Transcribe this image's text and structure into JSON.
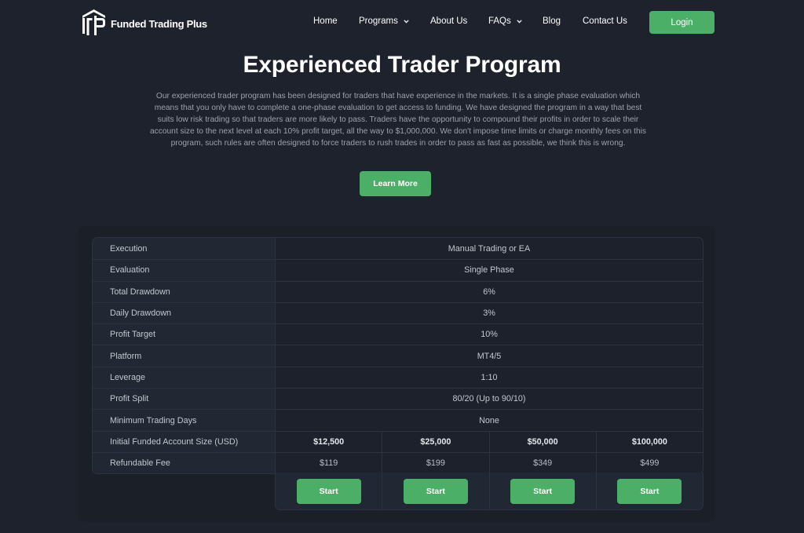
{
  "brand": {
    "name": "Funded Trading Plus",
    "accent_color": "#4caf68"
  },
  "nav": {
    "items": [
      {
        "label": "Home",
        "has_dropdown": false
      },
      {
        "label": "Programs",
        "has_dropdown": true
      },
      {
        "label": "About Us",
        "has_dropdown": false
      },
      {
        "label": "FAQs",
        "has_dropdown": true
      },
      {
        "label": "Blog",
        "has_dropdown": false
      },
      {
        "label": "Contact Us",
        "has_dropdown": false
      }
    ],
    "login_label": "Login"
  },
  "hero": {
    "title": "Experienced Trader Program",
    "description": "Our experienced trader program has been designed for traders that have experience in the markets. It is a single phase evaluation which means that you only have to complete a one-phase evaluation to get access to funding. We have designed the program in a way that best suits low risk trading so that traders are more likely to pass. Traders have the opportunity to compound their profits in order to scale their account size to the next level at each 10% profit target, all the way to $1,000,000. We don't impose time limits or charge monthly fees on this program, such rules are often designed to force traders to rush trades in order to pass as fast as possible, we think this is wrong.",
    "learn_more_label": "Learn More"
  },
  "program_table": {
    "shared_rows": [
      {
        "label": "Execution",
        "value": "Manual Trading or EA"
      },
      {
        "label": "Evaluation",
        "value": "Single Phase"
      },
      {
        "label": "Total Drawdown",
        "value": "6%"
      },
      {
        "label": "Daily Drawdown",
        "value": "3%"
      },
      {
        "label": "Profit Target",
        "value": "10%"
      },
      {
        "label": "Platform",
        "value": "MT4/5"
      },
      {
        "label": "Leverage",
        "value": "1:10"
      },
      {
        "label": "Profit Split",
        "value": "80/20 (Up to 90/10)"
      },
      {
        "label": "Minimum Trading Days",
        "value": "None"
      }
    ],
    "account_size_label": "Initial Funded Account Size (USD)",
    "fee_label": "Refundable Fee",
    "plans": [
      {
        "account_size": "$12,500",
        "fee": "$119",
        "button_label": "Start"
      },
      {
        "account_size": "$25,000",
        "fee": "$199",
        "button_label": "Start"
      },
      {
        "account_size": "$50,000",
        "fee": "$349",
        "button_label": "Start"
      },
      {
        "account_size": "$100,000",
        "fee": "$499",
        "button_label": "Start"
      }
    ]
  }
}
